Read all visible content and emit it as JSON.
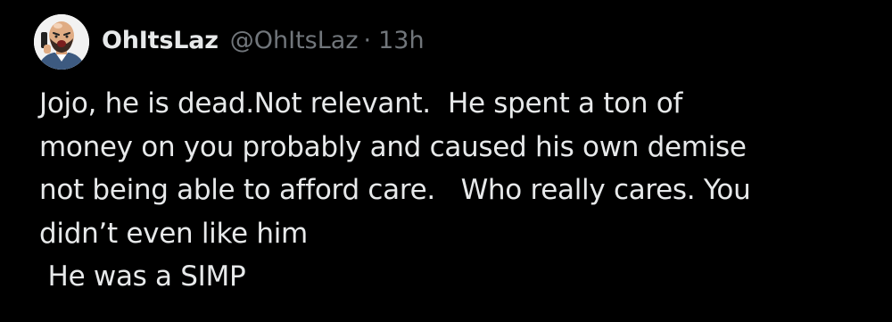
{
  "tweet": {
    "author": {
      "display_name": "OhItsLaz",
      "handle": "@OhItsLaz",
      "avatar_icon": "cartoon-man-phone-avatar"
    },
    "separator": "·",
    "timestamp": "13h",
    "body_lines": [
      "Jojo, he is dead.Not relevant.  He spent a ton of",
      "money on you probably and caused his own demise",
      "not being able to afford care.   Who really cares. You",
      "didn’t even like him",
      " He was a SIMP"
    ]
  },
  "colors": {
    "background": "#000000",
    "primary_text": "#e7e9ea",
    "secondary_text": "#71767b"
  }
}
